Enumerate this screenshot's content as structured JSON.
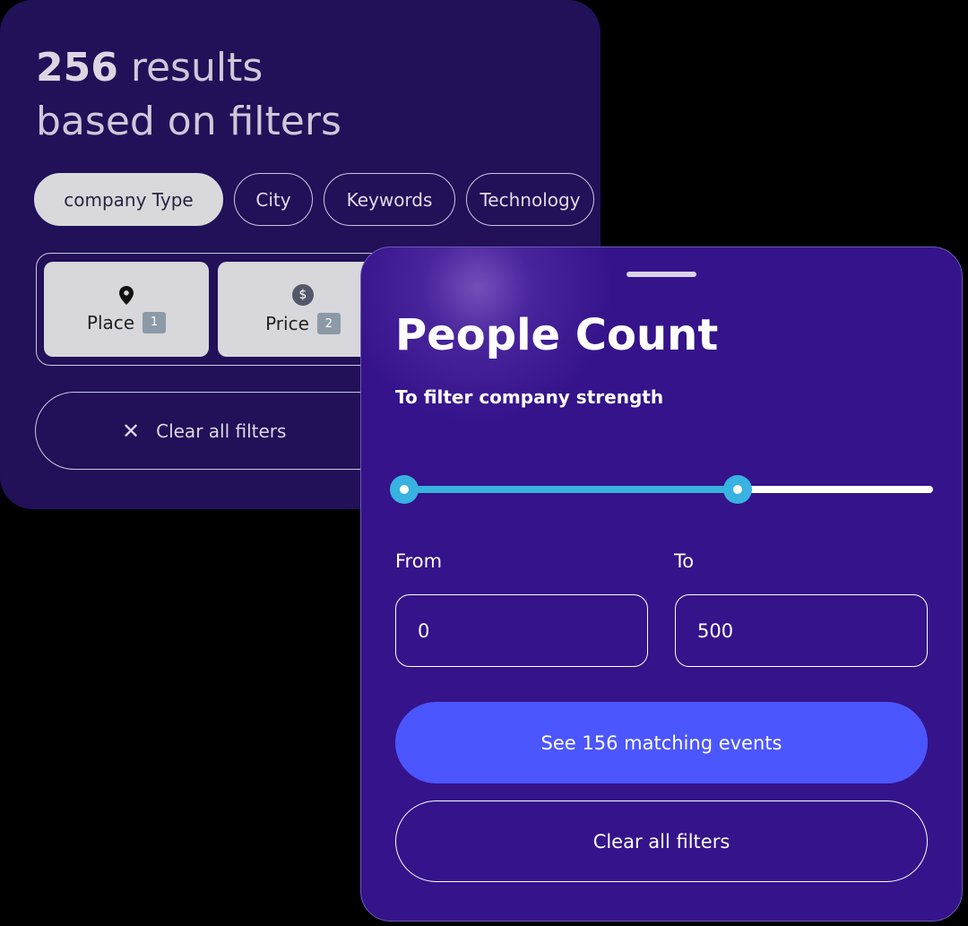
{
  "back_card": {
    "results_count": "256",
    "results_word": "results",
    "results_subtitle": "based on filters",
    "chips": [
      {
        "label": "company Type",
        "active": true
      },
      {
        "label": "City",
        "active": false
      },
      {
        "label": "Keywords",
        "active": false
      },
      {
        "label": "Technology",
        "active": false
      }
    ],
    "tiles": [
      {
        "label": "Place",
        "badge": "1",
        "icon": "map-pin-icon"
      },
      {
        "label": "Price",
        "badge": "2",
        "icon": "dollar-coin-icon",
        "icon_glyph": "$"
      }
    ],
    "clear_label": "Clear all filters",
    "clear_icon": "close-icon"
  },
  "people_count": {
    "title": "People Count",
    "subtitle": "To filter company strength",
    "slider": {
      "low_fraction": 0.0,
      "high_fraction": 0.63
    },
    "from_label": "From",
    "to_label": "To",
    "from_value": "0",
    "to_value": "500",
    "primary_button": "See 156 matching events",
    "clear_button": "Clear all filters"
  },
  "colors": {
    "back_card_bg": "#221058",
    "front_card_bg": "#35138a",
    "slider_accent": "#38b2e0",
    "primary_button": "#4b56fe"
  }
}
